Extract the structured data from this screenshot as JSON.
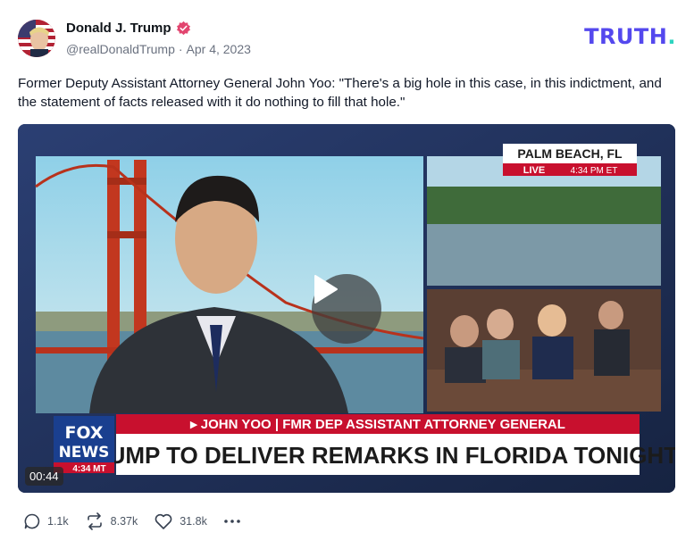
{
  "post": {
    "author_name": "Donald J. Trump",
    "handle": "@realDonaldTrump",
    "separator": "·",
    "date": "Apr 4, 2023",
    "text": "Former Deputy Assistant Attorney General John Yoo: \"There's a big hole in this case, in this indictment, and the statement of facts released with it do nothing to fill that hole.\""
  },
  "brand": {
    "logo_text": "TRUTH",
    "logo_dot": ".",
    "logo_color": "#5448ee",
    "dot_color": "#2dd4bf"
  },
  "video": {
    "duration": "00:44",
    "location": "PALM BEACH, FL",
    "live_label": "LIVE",
    "live_time": "4:34 PM ET",
    "lower_third_name": "▸ JOHN YOO | FMR DEP ASSISTANT ATTORNEY GENERAL",
    "headline": "TRUMP TO DELIVER REMARKS IN FLORIDA TONIGHT",
    "network_line1": "FOX",
    "network_line2": "NEWS",
    "network_time": "4:34 MT"
  },
  "actions": {
    "replies": "1.1k",
    "retruths": "8.37k",
    "likes": "31.8k"
  },
  "icons": [
    "verified-badge-icon",
    "reply-icon",
    "retruth-icon",
    "like-icon",
    "more-icon",
    "play-icon"
  ]
}
